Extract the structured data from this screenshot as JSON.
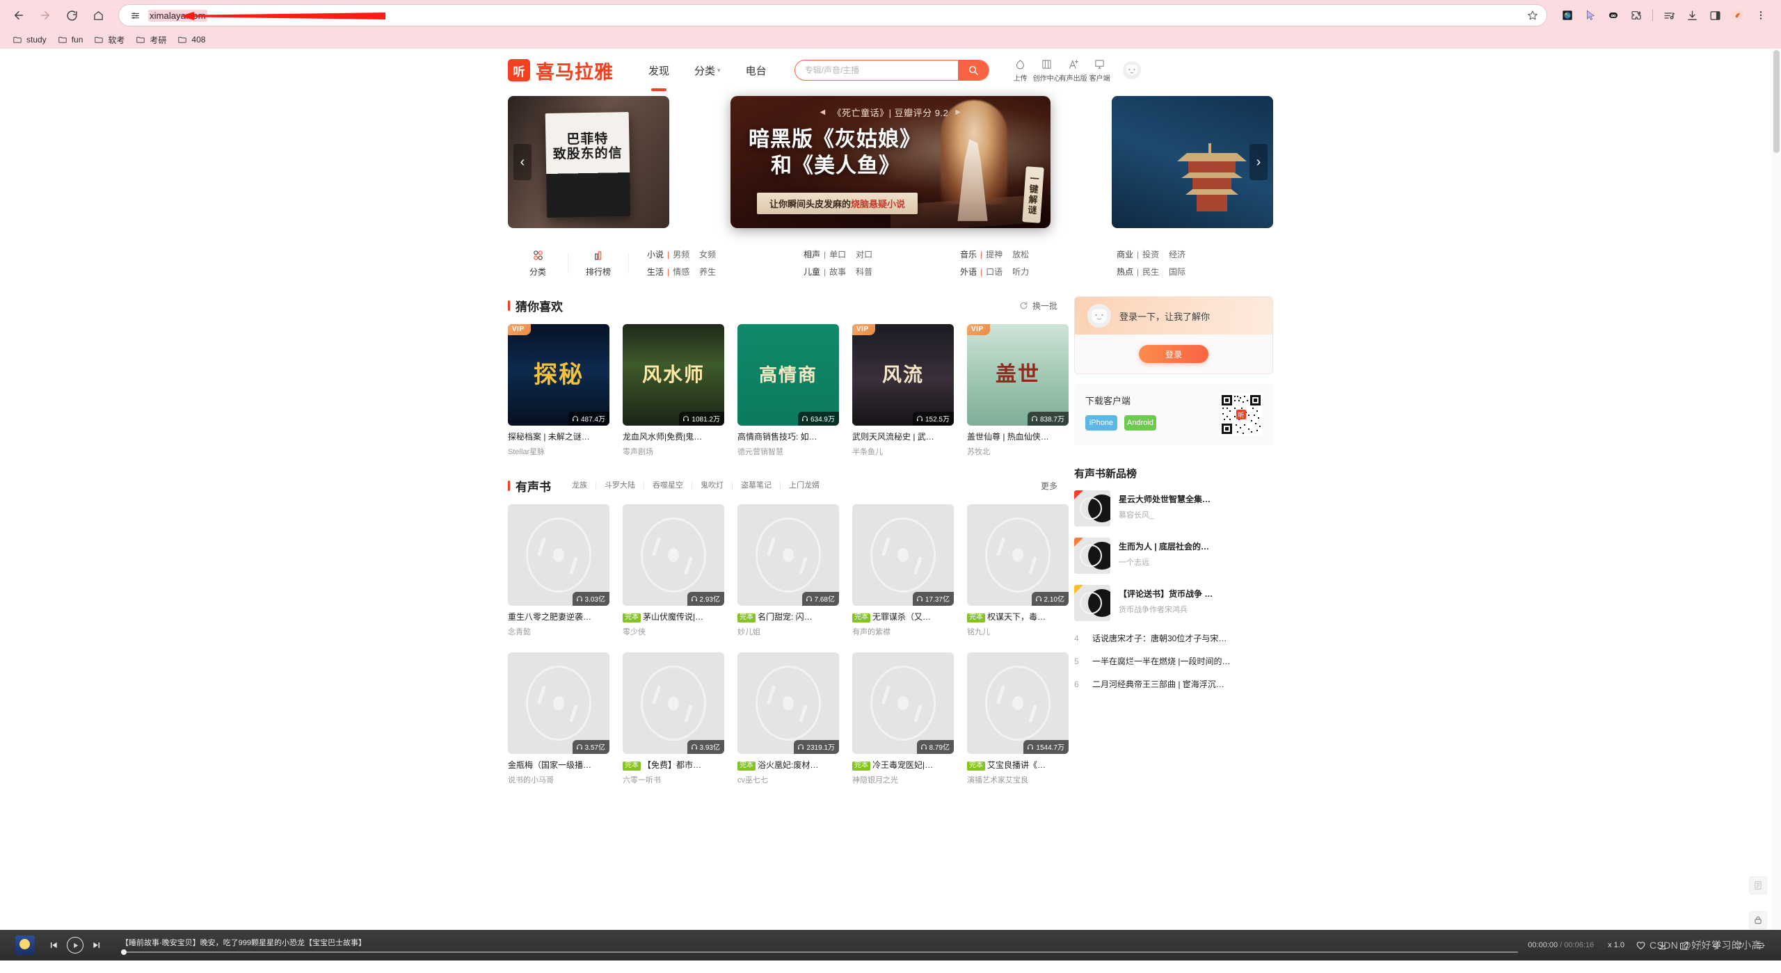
{
  "browser": {
    "url": "ximalaya.com",
    "nav": {
      "back": "back-arrow",
      "forward": "forward-arrow",
      "reload": "reload",
      "home": "home"
    },
    "bookmarks": [
      {
        "label": "study"
      },
      {
        "label": "fun"
      },
      {
        "label": "软考"
      },
      {
        "label": "考研"
      },
      {
        "label": "408"
      }
    ]
  },
  "site": {
    "logo_mark": "听",
    "logo_text": "喜马拉雅",
    "nav": [
      {
        "label": "发现",
        "active": true,
        "caret": false
      },
      {
        "label": "分类",
        "active": false,
        "caret": true
      },
      {
        "label": "电台",
        "active": false,
        "caret": false
      }
    ],
    "search": {
      "placeholder": "专辑/声音/主播",
      "value": ""
    },
    "tools": [
      {
        "label": "上传",
        "icon": "upload-icon"
      },
      {
        "label": "创作中心",
        "icon": "creator-icon"
      },
      {
        "label": "有声出版",
        "icon": "publish-icon"
      },
      {
        "label": "客户端",
        "icon": "desktop-icon"
      }
    ]
  },
  "banner": {
    "eyebrow": "《死亡童话》|  豆瓣评分 9.2",
    "title_line1": "暗黑版《灰姑娘》",
    "title_line2": "和《美人鱼》",
    "subtitle_pre": "让你瞬间头皮发麻的",
    "subtitle_hl": "烧脑悬疑小说",
    "side_tag": "一键解谜",
    "left_book": "巴菲特\n致股东的信",
    "prev": "‹",
    "next": "›"
  },
  "catnav": {
    "big": [
      {
        "label": "分类",
        "icon": "grid-icon"
      },
      {
        "label": "排行榜",
        "icon": "chart-icon"
      }
    ],
    "columns": [
      {
        "rows": [
          {
            "main": "小说",
            "subs": [
              "男频",
              "女频"
            ]
          },
          {
            "main": "生活",
            "subs": [
              "情感",
              "养生"
            ]
          }
        ]
      },
      {
        "rows": [
          {
            "main": "相声",
            "subs": [
              "单口",
              "对口"
            ]
          },
          {
            "main": "儿童",
            "subs": [
              "故事",
              "科普"
            ]
          }
        ]
      },
      {
        "rows": [
          {
            "main": "音乐",
            "subs": [
              "提神",
              "放松"
            ]
          },
          {
            "main": "外语",
            "subs": [
              "口语",
              "听力"
            ]
          }
        ]
      },
      {
        "rows": [
          {
            "main": "商业",
            "subs": [
              "投资",
              "经济"
            ]
          },
          {
            "main": "热点",
            "subs": [
              "民生",
              "国际"
            ]
          }
        ]
      }
    ]
  },
  "guess": {
    "title": "猜你喜欢",
    "refresh": "换一批",
    "cards": [
      {
        "vip": "VIP",
        "plays": "487.4万",
        "title": "探秘档案 | 未解之谜…",
        "author": "Stellar星脉",
        "art": "探秘",
        "art_class": "g1",
        "art_color": "#f3c23a"
      },
      {
        "vip": "",
        "plays": "1081.2万",
        "title": "龙血风水师|免费|鬼…",
        "author": "零声剧场",
        "art": "风水师",
        "art_class": "g2",
        "art_color": "#ffe9a8"
      },
      {
        "vip": "",
        "plays": "634.9万",
        "title": "高情商销售技巧: 如…",
        "author": "德元营销智慧",
        "art": "高情商",
        "art_class": "g3",
        "art_color": "#f6e9c4"
      },
      {
        "vip": "VIP",
        "plays": "152.5万",
        "title": "武则天风流秘史 | 武…",
        "author": "半条鱼儿",
        "art": "风流",
        "art_class": "g4",
        "art_color": "#f6e7c8"
      },
      {
        "vip": "VIP",
        "plays": "838.7万",
        "title": "盖世仙尊 | 热血仙侠…",
        "author": "苏牧北",
        "art": "盖世",
        "art_class": "g5",
        "art_color": "#8f2b20"
      }
    ]
  },
  "audiobook": {
    "title": "有声书",
    "tabs": [
      "龙族",
      "斗罗大陆",
      "吞噬星空",
      "鬼吹灯",
      "盗墓笔记",
      "上门龙婿"
    ],
    "more": "更多",
    "row1": [
      {
        "finish": "",
        "plays": "3.03亿",
        "title": "重生八零之肥妻逆袭…",
        "author": "念青懿"
      },
      {
        "finish": "完本",
        "plays": "2.93亿",
        "title": "茅山伏魔传说|…",
        "author": "零少侠"
      },
      {
        "finish": "完本",
        "plays": "7.68亿",
        "title": "名门甜宠: 闪…",
        "author": "妙儿姐"
      },
      {
        "finish": "完本",
        "plays": "17.37亿",
        "title": "无罪谋杀（又…",
        "author": "有声的紫襟"
      },
      {
        "finish": "完本",
        "plays": "2.10亿",
        "title": "权谋天下，毒…",
        "author": "铭九儿"
      }
    ],
    "row2": [
      {
        "finish": "",
        "plays": "3.57亿",
        "title": "金瓶梅（国家一级播…",
        "author": "说书的小马哥"
      },
      {
        "finish": "完本",
        "plays": "3.93亿",
        "title": "【免费】都市…",
        "author": "六零一听书"
      },
      {
        "finish": "完本",
        "plays": "2319.1万",
        "title": "浴火凰妃:废材…",
        "author": "cv巫七七"
      },
      {
        "finish": "完本",
        "plays": "8.79亿",
        "title": "冷王毒宠医妃|…",
        "author": "神隐银月之光"
      },
      {
        "finish": "完本",
        "plays": "1544.7万",
        "title": "艾宝良播讲《…",
        "author": "演播艺术家艾宝良"
      }
    ]
  },
  "sidebar": {
    "login": {
      "text": "登录一下，让我了解你",
      "button": "登录"
    },
    "download": {
      "title": "下载客户端",
      "ios": "iPhone",
      "android": "Android",
      "qr_logo": "听"
    },
    "rank": {
      "title": "有声书新品榜",
      "top": [
        {
          "name": "星云大师处世智慧全集…",
          "author": "慕容长风_"
        },
        {
          "name": "生而为人 | 底层社会的…",
          "author": "一个志远"
        },
        {
          "name": "【评论送书】货币战争 …",
          "author": "货币战争作者宋鸿兵"
        }
      ],
      "rest": [
        {
          "num": "4",
          "line": "话说唐宋才子：唐朝30位才子与宋…"
        },
        {
          "num": "5",
          "line": "一半在腐烂一半在燃烧 |一段时间的…"
        },
        {
          "num": "6",
          "line": "二月河经典帝王三部曲 | 宦海浮沉…"
        }
      ]
    }
  },
  "player": {
    "title": "【睡前故事·晚安宝贝】晚安，吃了999颗星星的小恐龙【宝宝巴士故事】",
    "current_time": "00:00:00",
    "total_time": "00:06:16",
    "speed": "x 1.0",
    "watermark": "CSDN @好好学习的小高",
    "icons": [
      "prev-track-icon",
      "play-icon",
      "next-track-icon",
      "heart-icon",
      "download-icon",
      "share-icon",
      "volume-icon",
      "repeat-icon",
      "playlist-icon"
    ]
  }
}
